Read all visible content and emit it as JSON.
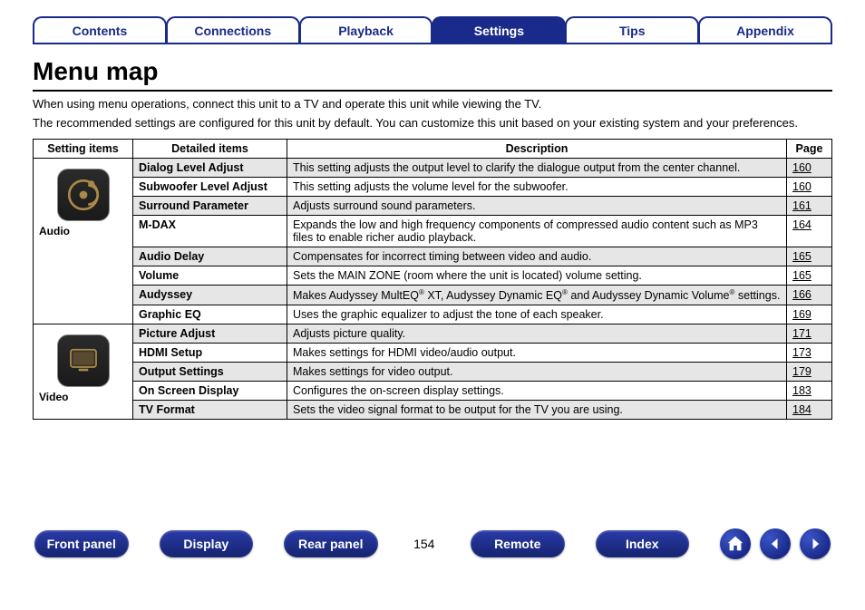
{
  "tabs": [
    {
      "label": "Contents",
      "active": false
    },
    {
      "label": "Connections",
      "active": false
    },
    {
      "label": "Playback",
      "active": false
    },
    {
      "label": "Settings",
      "active": true
    },
    {
      "label": "Tips",
      "active": false
    },
    {
      "label": "Appendix",
      "active": false
    }
  ],
  "title": "Menu map",
  "intro": {
    "line1": "When using menu operations, connect this unit to a TV and operate this unit while viewing the TV.",
    "line2": "The recommended settings are configured for this unit by default. You can customize this unit based on your existing system and your preferences."
  },
  "table": {
    "headers": {
      "c1": "Setting items",
      "c2": "Detailed items",
      "c3": "Description",
      "c4": "Page"
    },
    "groups": [
      {
        "name": "Audio",
        "icon": "audio",
        "rows": [
          {
            "item": "Dialog Level Adjust",
            "desc": "This setting adjusts the output level to clarify the dialogue output from the center channel.",
            "page": "160",
            "shaded": true
          },
          {
            "item": "Subwoofer Level Adjust",
            "desc": "This setting adjusts the volume level for the subwoofer.",
            "page": "160",
            "shaded": false
          },
          {
            "item": "Surround Parameter",
            "desc": "Adjusts surround sound parameters.",
            "page": "161",
            "shaded": true
          },
          {
            "item": "M-DAX",
            "desc": "Expands the low and high frequency components of compressed audio content such as MP3 files to enable richer audio playback.",
            "page": "164",
            "shaded": false
          },
          {
            "item": "Audio Delay",
            "desc": "Compensates for incorrect timing between video and audio.",
            "page": "165",
            "shaded": true
          },
          {
            "item": "Volume",
            "desc": "Sets the MAIN ZONE (room where the unit is located) volume setting.",
            "page": "165",
            "shaded": false
          },
          {
            "item": "Audyssey",
            "desc_html": "Makes Audyssey MultEQ<sup>®</sup> XT, Audyssey Dynamic EQ<sup>®</sup> and Audyssey Dynamic Volume<sup>®</sup> settings.",
            "page": "166",
            "shaded": true
          },
          {
            "item": "Graphic EQ",
            "desc": "Uses the graphic equalizer to adjust the tone of each speaker.",
            "page": "169",
            "shaded": false
          }
        ]
      },
      {
        "name": "Video",
        "icon": "video",
        "rows": [
          {
            "item": "Picture Adjust",
            "desc": "Adjusts picture quality.",
            "page": "171",
            "shaded": true
          },
          {
            "item": "HDMI Setup",
            "desc": "Makes settings for HDMI video/audio output.",
            "page": "173",
            "shaded": false
          },
          {
            "item": "Output Settings",
            "desc": "Makes settings for video output.",
            "page": "179",
            "shaded": true
          },
          {
            "item": "On Screen Display",
            "desc": "Configures the on-screen display settings.",
            "page": "183",
            "shaded": false
          },
          {
            "item": "TV Format",
            "desc": "Sets the video signal format to be output for the TV you are using.",
            "page": "184",
            "shaded": true
          }
        ]
      }
    ]
  },
  "bottom": {
    "pills": [
      "Front panel",
      "Display",
      "Rear panel"
    ],
    "pagenum": "154",
    "pills2": [
      "Remote",
      "Index"
    ]
  }
}
